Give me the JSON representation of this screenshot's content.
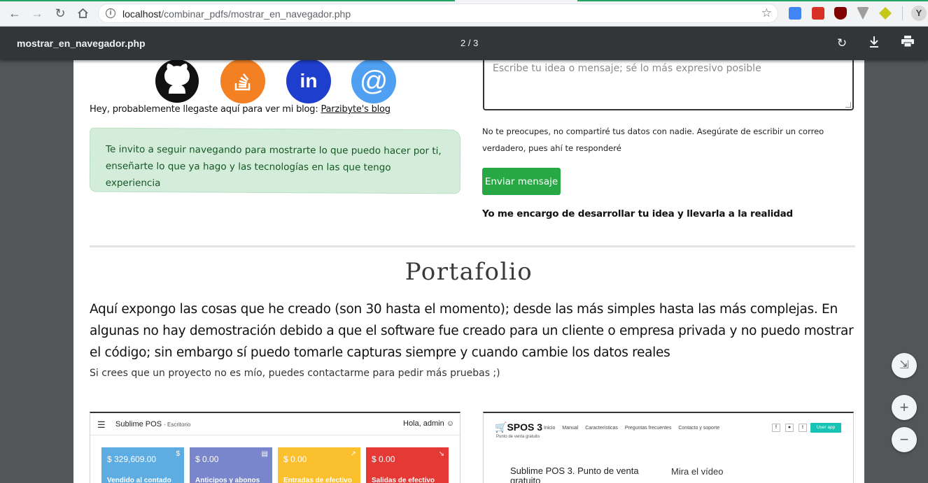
{
  "browser": {
    "url_host": "localhost",
    "url_path": "/combinar_pdfs/mostrar_en_navegador.php"
  },
  "pdf_viewer": {
    "title": "mostrar_en_navegador.php",
    "page_indicator": "2 / 3"
  },
  "contact": {
    "blog_prefix": "Hey, probablemente llegaste aquí para ver mi blog: ",
    "blog_link": "Parzibyte's blog",
    "alert_text": "Te invito a seguir navegando para mostrarte lo que puedo hacer por ti, enseñarte lo que ya hago y las tecnologías en las que tengo experiencia",
    "message_placeholder": "Escribe tu idea o mensaje; sé lo más expresivo posible",
    "privacy_note": "No te preocupes, no compartiré tus datos con nadie. Asegúrate de escribir un correo verdadero, pues ahí te responderé",
    "send_button": "Enviar mensaje",
    "promise": "Yo me encargo de desarrollar tu idea y llevarla a la realidad",
    "social_icons": [
      "github-icon",
      "stackoverflow-icon",
      "linkedin-icon",
      "email-icon"
    ]
  },
  "portfolio": {
    "title": "Portafolio",
    "description": "Aquí expongo las cosas que he creado (son 30 hasta el momento); desde las más simples hasta las más complejas. En algunas no hay demostración debido a que el software fue creado para un cliente o empresa privada y no puedo mostrar el código; sin embargo sí puedo tomarle capturas siempre y cuando cambie los datos reales",
    "subnote": "Si crees que un proyecto no es mío, puedes contactarme para pedir más pruebas ;)"
  },
  "card_pos": {
    "app_title": "Sublime POS",
    "app_subtitle": "- Escritorio",
    "greeting": "Hola, admin",
    "tiles": [
      {
        "amount": "$ 329,609.00",
        "label": "Vendido al contado",
        "color": "#5dade2"
      },
      {
        "amount": "$ 0.00",
        "label": "Anticipos y abonos",
        "color": "#7986cb"
      },
      {
        "amount": "$ 0.00",
        "label": "Entradas de efectivo",
        "color": "#fbc02d"
      },
      {
        "amount": "$ 0.00",
        "label": "Salidas de efectivo",
        "color": "#e53935"
      }
    ]
  },
  "card_spos": {
    "logo": "SPOS 3",
    "logo_sub": "Punto de venta gratuito",
    "nav": [
      "Inicio",
      "Manual",
      "Características",
      "Preguntas frecuentes",
      "Contacto y soporte"
    ],
    "user_app": "User app",
    "heading": "Sublime POS 3. Punto de venta gratuito",
    "video_link": "Mira el vídeo"
  }
}
